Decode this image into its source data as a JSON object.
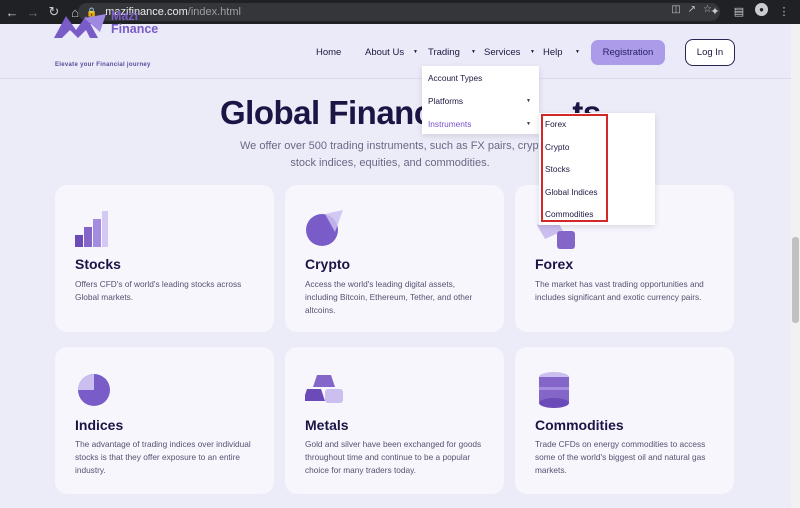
{
  "browser": {
    "url_host": "mazifinance.com",
    "url_path": "/index.html"
  },
  "brand": {
    "name_line1": "Mazi",
    "name_line2": "Finance",
    "tagline": "Elevate your Financial journey",
    "accent_color": "#7a5cc8"
  },
  "nav": {
    "home": "Home",
    "about": "About Us",
    "trading": "Trading",
    "services": "Services",
    "help": "Help",
    "register": "Registration",
    "login": "Log In"
  },
  "trading_menu": {
    "items": [
      "Account Types",
      "Platforms",
      "Instruments"
    ]
  },
  "instruments_menu": {
    "items": [
      "Forex",
      "Crypto",
      "Stocks",
      "Global Indices",
      "Commodities"
    ]
  },
  "hero": {
    "title": "Global Financi",
    "title_tail": "ts",
    "subtitle_line1": "We offer over 500 trading instruments, such as FX pairs, crypt",
    "subtitle_line2": "stock indices, equities, and commodities."
  },
  "cards": [
    {
      "title": "Stocks",
      "desc": "Offers CFD's of world's leading stocks across Global markets.",
      "icon": "stocks-icon"
    },
    {
      "title": "Crypto",
      "desc": "Access the world's leading digital assets, including Bitcoin, Ethereum, Tether, and other altcoins.",
      "icon": "crypto-icon"
    },
    {
      "title": "Forex",
      "desc": "The market has vast trading opportunities and includes significant and exotic currency pairs.",
      "icon": "forex-icon"
    },
    {
      "title": "Indices",
      "desc": "The advantage of trading indices over individual stocks is that they offer exposure to an entire industry.",
      "icon": "indices-icon"
    },
    {
      "title": "Metals",
      "desc": "Gold and silver have been exchanged for goods throughout time and continue to be a popular choice for many traders today.",
      "icon": "metals-icon"
    },
    {
      "title": "Commodities",
      "desc": "Trade CFDs on energy commodities to access some of the world's biggest oil and natural gas markets.",
      "icon": "commodities-icon"
    }
  ]
}
